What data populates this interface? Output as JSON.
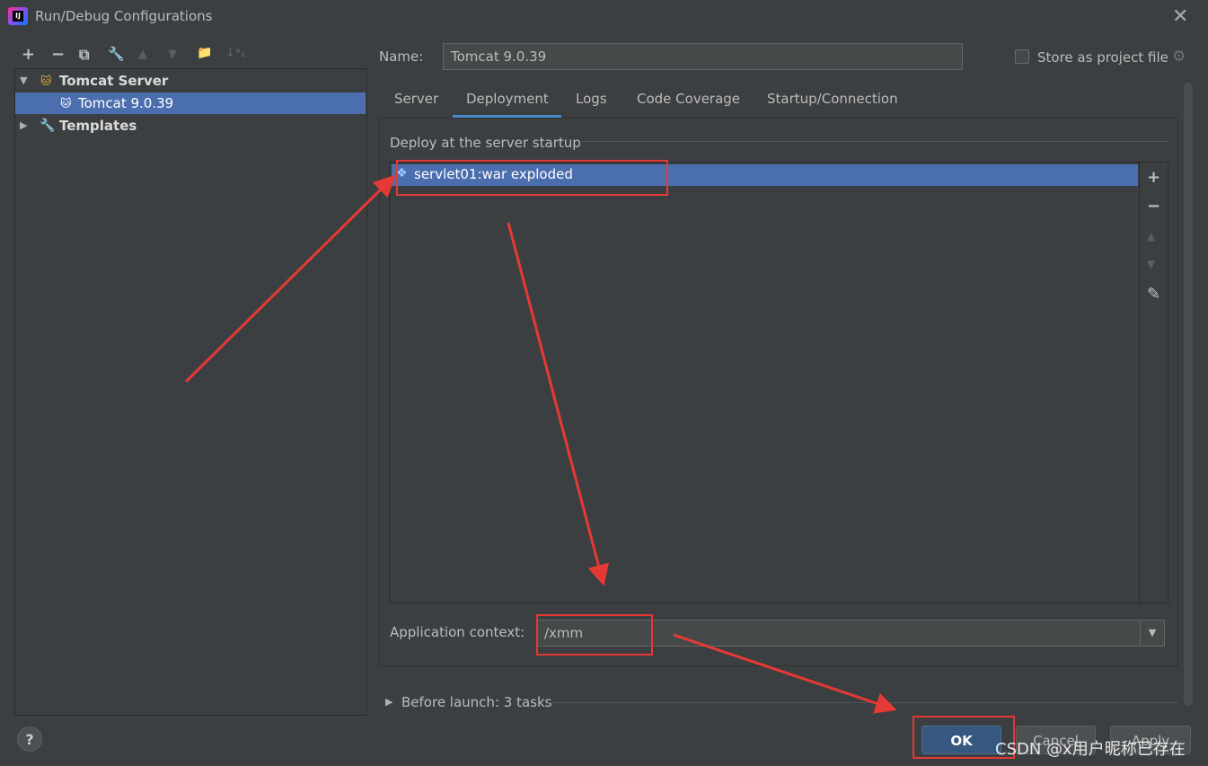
{
  "window": {
    "title": "Run/Debug Configurations",
    "close_glyph": "✕"
  },
  "toolbar": {
    "add": "+",
    "remove": "−",
    "copy": "⧉",
    "edit": "🔧",
    "up": "▲",
    "down": "▼",
    "folder": "📁",
    "sort": "↓ᵃ₂"
  },
  "tree": {
    "items": [
      {
        "label": "Tomcat Server",
        "expanded": true
      },
      {
        "label": "Tomcat 9.0.39",
        "selected": true
      },
      {
        "label": "Templates",
        "expanded": false
      }
    ]
  },
  "name_field": {
    "label": "Name:",
    "value": "Tomcat 9.0.39"
  },
  "store": {
    "label": "Store as project file",
    "checked": false
  },
  "tabs": [
    {
      "label": "Server"
    },
    {
      "label": "Deployment",
      "active": true
    },
    {
      "label": "Logs"
    },
    {
      "label": "Code Coverage"
    },
    {
      "label": "Startup/Connection"
    }
  ],
  "deploy": {
    "section_title": "Deploy at the server startup",
    "artifacts": [
      "servlet01:war exploded"
    ],
    "tools": {
      "add": "+",
      "remove": "−",
      "up": "▲",
      "down": "▼",
      "edit": "✎"
    }
  },
  "app_context": {
    "label": "Application context:",
    "value": "/xmm"
  },
  "before_launch": {
    "label": "Before launch: 3 tasks"
  },
  "buttons": {
    "help": "?",
    "ok": "OK",
    "cancel": "Cancel",
    "apply": "Apply"
  },
  "watermark": "CSDN @x用户昵称已存在",
  "colors": {
    "accent": "#4b6eaf",
    "annotation": "#e53935",
    "background": "#3c3f41"
  }
}
